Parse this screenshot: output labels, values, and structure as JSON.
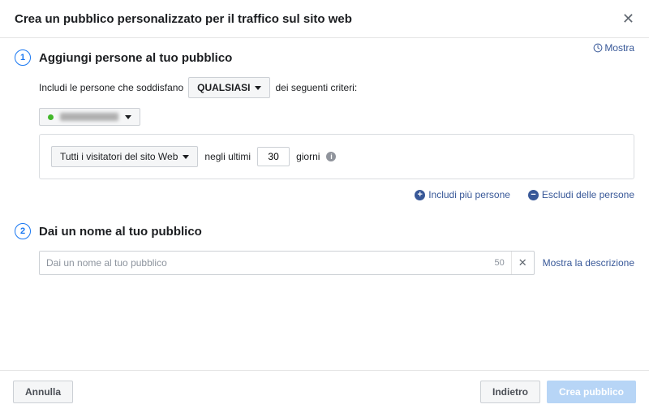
{
  "header": {
    "title": "Crea un pubblico personalizzato per il traffico sul sito web"
  },
  "top_link": {
    "label": "Mostra"
  },
  "section1": {
    "step": "1",
    "title": "Aggiungi persone al tuo pubblico",
    "include_prefix": "Includi le persone che soddisfano",
    "match_mode": "QUALSIASI",
    "include_suffix": "dei seguenti criteri:",
    "criteria_selector": "Tutti i visitatori del sito Web",
    "in_last": "negli ultimi",
    "days_value": "30",
    "days_label": "giorni",
    "add_include": "Includi più persone",
    "add_exclude": "Escludi delle persone"
  },
  "section2": {
    "step": "2",
    "title": "Dai un nome al tuo pubblico",
    "name_placeholder": "Dai un nome al tuo pubblico",
    "char_remaining": "50",
    "show_desc": "Mostra la descrizione"
  },
  "footer": {
    "cancel": "Annulla",
    "back": "Indietro",
    "create": "Crea pubblico"
  }
}
